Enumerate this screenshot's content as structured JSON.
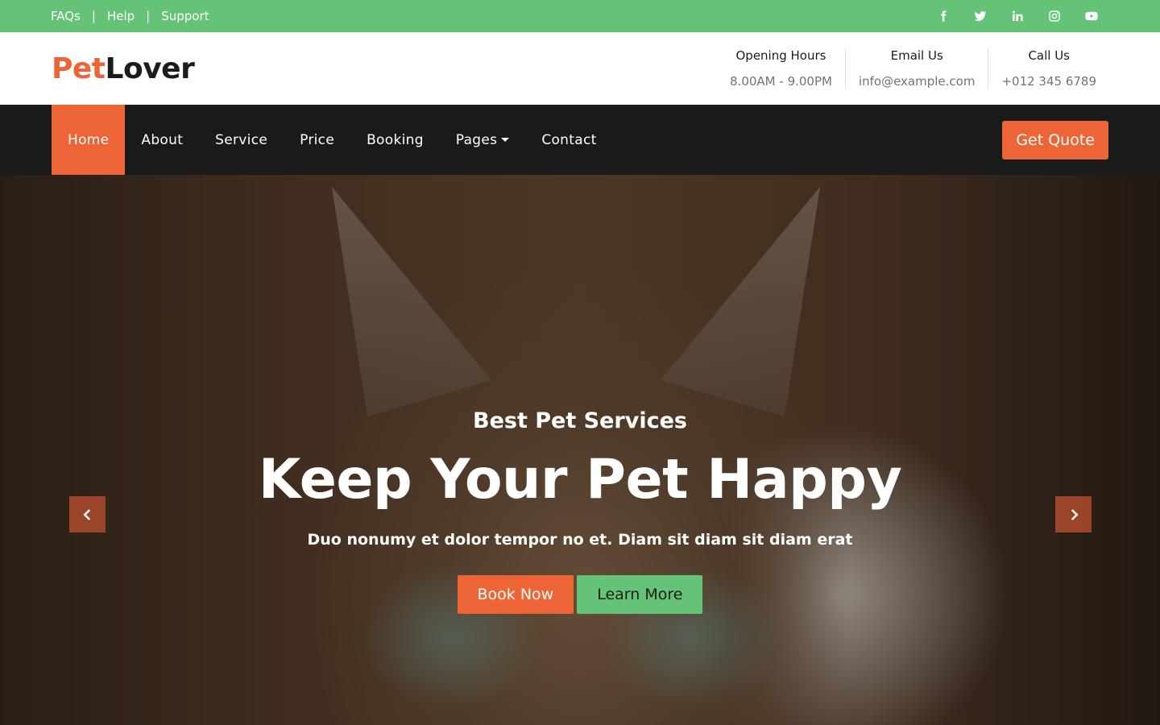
{
  "topbar": {
    "links": [
      "FAQs",
      "Help",
      "Support"
    ],
    "separator": "|",
    "socials": [
      "facebook-icon",
      "twitter-icon",
      "linkedin-icon",
      "instagram-icon",
      "youtube-icon"
    ]
  },
  "header": {
    "logo_part1": "Pet",
    "logo_part2": "Lover",
    "info": [
      {
        "title": "Opening Hours",
        "value": "8.00AM - 9.00PM"
      },
      {
        "title": "Email Us",
        "value": "info@example.com"
      },
      {
        "title": "Call Us",
        "value": "+012 345 6789"
      }
    ]
  },
  "nav": {
    "items": [
      "Home",
      "About",
      "Service",
      "Price",
      "Booking",
      "Pages",
      "Contact"
    ],
    "active": "Home",
    "quote_label": "Get Quote"
  },
  "hero": {
    "subtitle": "Best Pet Services",
    "title": "Keep Your Pet Happy",
    "text": "Duo nonumy et dolor tempor no et. Diam sit diam sit diam erat",
    "primary_button": "Book Now",
    "secondary_button": "Learn More"
  },
  "colors": {
    "accent": "#ed6436",
    "green": "#65c378",
    "dark": "#1a1a1a"
  }
}
